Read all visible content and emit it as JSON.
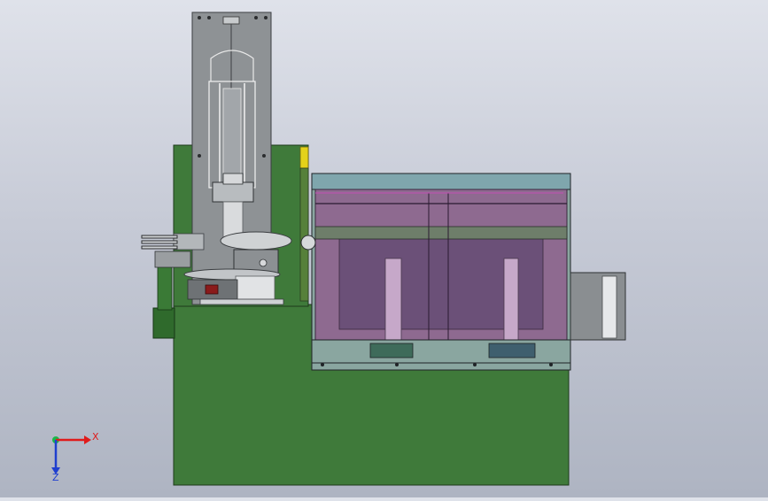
{
  "triad": {
    "x_label": "X",
    "z_label": "Z"
  },
  "colors": {
    "base_green": "#3f7a3a",
    "frame_gray": "#8e9295",
    "tank_purple": "#7c5c82",
    "accent_yellow": "#e4d21a",
    "axis_red": "#e01b1b",
    "axis_blue": "#1f3fcf",
    "axis_green": "#19b84a"
  }
}
